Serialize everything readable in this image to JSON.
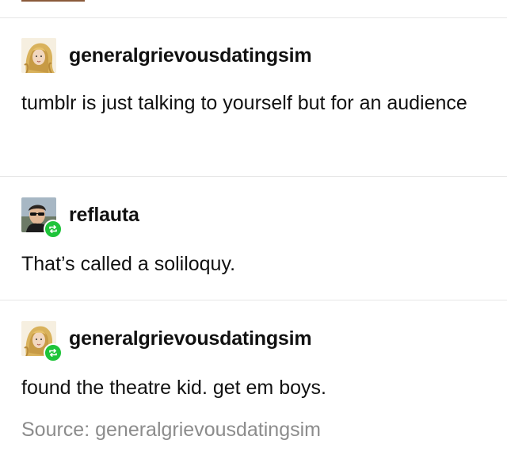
{
  "posts": [
    {
      "username": "generalgrievousdatingsim",
      "body": "tumblr is just talking to yourself but for an audience",
      "reblog": false
    },
    {
      "username": "reflauta",
      "body": "That’s called a soliloquy.",
      "reblog": true
    },
    {
      "username": "generalgrievousdatingsim",
      "body": "found the theatre kid. get em boys.",
      "reblog": true
    }
  ],
  "source": {
    "text": "Source: generalgrievousdatingsim"
  },
  "colors": {
    "reblog_badge": "#1ec43a",
    "divider": "#e6e6e6",
    "source_text": "#8c8c8c"
  },
  "icons": {
    "reblog": "reblog-arrows-icon"
  }
}
